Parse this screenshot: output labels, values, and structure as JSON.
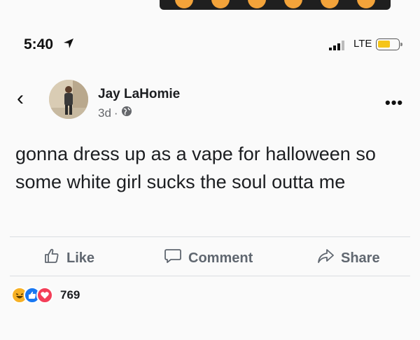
{
  "status_bar": {
    "time": "5:40",
    "network": "LTE"
  },
  "post": {
    "author": "Jay LaHomie",
    "age": "3d",
    "separator": "·",
    "text": "gonna dress up as a vape for halloween so some white girl sucks the soul outta me"
  },
  "actions": {
    "like": "Like",
    "comment": "Comment",
    "share": "Share"
  },
  "reactions": {
    "count": "769",
    "types": [
      "haha",
      "like",
      "love"
    ]
  },
  "colors": {
    "facebook_blue": "#1877f2",
    "love_red": "#f33e58",
    "haha_yellow": "#f7b125",
    "text_primary": "#1c1e21",
    "text_secondary": "#65676b"
  }
}
